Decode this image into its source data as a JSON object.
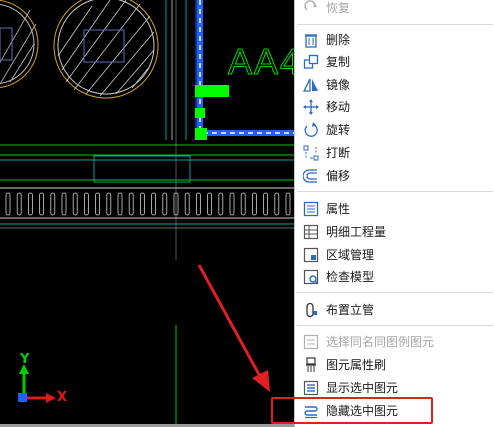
{
  "cad": {
    "room_label": "AA4",
    "axis_x": "X",
    "axis_y": "Y"
  },
  "menu": {
    "items": [
      {
        "label": "恢复",
        "icon": "redo-icon",
        "enabled": false
      },
      {
        "label": "删除",
        "icon": "trash-icon",
        "enabled": true
      },
      {
        "label": "复制",
        "icon": "copy-icon",
        "enabled": true
      },
      {
        "label": "镜像",
        "icon": "mirror-icon",
        "enabled": true
      },
      {
        "label": "移动",
        "icon": "move-icon",
        "enabled": true
      },
      {
        "label": "旋转",
        "icon": "rotate-icon",
        "enabled": true
      },
      {
        "label": "打断",
        "icon": "break-icon",
        "enabled": true
      },
      {
        "label": "偏移",
        "icon": "offset-icon",
        "enabled": true
      },
      {
        "label": "属性",
        "icon": "properties-icon",
        "enabled": true
      },
      {
        "label": "明细工程量",
        "icon": "quantity-icon",
        "enabled": true
      },
      {
        "label": "区域管理",
        "icon": "region-icon",
        "enabled": true
      },
      {
        "label": "检查模型",
        "icon": "check-model-icon",
        "enabled": true
      },
      {
        "label": "布置立管",
        "icon": "riser-icon",
        "enabled": true
      },
      {
        "label": "选择同名同图例图元",
        "icon": "select-same-icon",
        "enabled": false
      },
      {
        "label": "图元属性刷",
        "icon": "brush-icon",
        "enabled": true
      },
      {
        "label": "显示选中图元",
        "icon": "show-selected-icon",
        "enabled": true
      },
      {
        "label": "隐藏选中图元",
        "icon": "hide-selected-icon",
        "enabled": true
      }
    ]
  },
  "colors": {
    "highlight": "#e02020",
    "icon_blue": "#2b6cc4",
    "cad_green": "#00ff00",
    "cad_cyan": "#00c8c8",
    "cad_blue": "#2060ff",
    "cad_yellow": "#d4a017"
  }
}
